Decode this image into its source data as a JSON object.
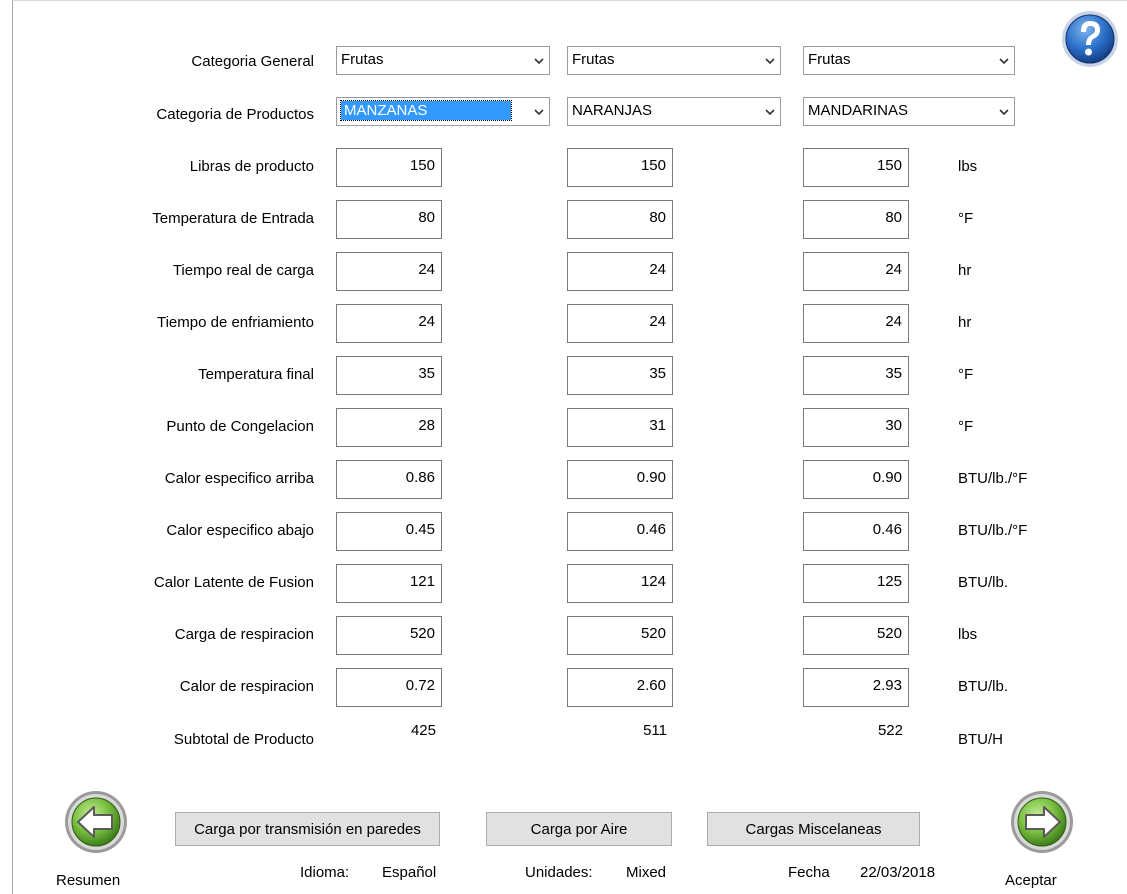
{
  "help_icon": "help-question-icon",
  "row_labels": {
    "categoria_general": "Categoria General",
    "categoria_productos": "Categoria de Productos",
    "libras": "Libras de producto",
    "temp_entrada": "Temperatura de Entrada",
    "tiempo_carga": "Tiempo real de carga",
    "tiempo_enfriamiento": "Tiempo de enfriamiento",
    "temp_final": "Temperatura final",
    "punto_congelacion": "Punto de Congelacion",
    "calor_arriba": "Calor especifico arriba",
    "calor_abajo": "Calor especifico abajo",
    "calor_latente": "Calor Latente de Fusion",
    "carga_respiracion": "Carga de respiracion",
    "calor_respiracion": "Calor de respiracion",
    "subtotal": "Subtotal de Producto"
  },
  "columns": [
    {
      "categoria_general": "Frutas",
      "categoria_productos": "MANZANAS",
      "libras": "150",
      "temp_entrada": "80",
      "tiempo_carga": "24",
      "tiempo_enfriamiento": "24",
      "temp_final": "35",
      "punto_congelacion": "28",
      "calor_arriba": "0.86",
      "calor_abajo": "0.45",
      "calor_latente": "121",
      "carga_respiracion": "520",
      "calor_respiracion": "0.72",
      "subtotal": "425"
    },
    {
      "categoria_general": "Frutas",
      "categoria_productos": "NARANJAS",
      "libras": "150",
      "temp_entrada": "80",
      "tiempo_carga": "24",
      "tiempo_enfriamiento": "24",
      "temp_final": "35",
      "punto_congelacion": "31",
      "calor_arriba": "0.90",
      "calor_abajo": "0.46",
      "calor_latente": "124",
      "carga_respiracion": "520",
      "calor_respiracion": "2.60",
      "subtotal": "511"
    },
    {
      "categoria_general": "Frutas",
      "categoria_productos": "MANDARINAS",
      "libras": "150",
      "temp_entrada": "80",
      "tiempo_carga": "24",
      "tiempo_enfriamiento": "24",
      "temp_final": "35",
      "punto_congelacion": "30",
      "calor_arriba": "0.90",
      "calor_abajo": "0.46",
      "calor_latente": "125",
      "carga_respiracion": "520",
      "calor_respiracion": "2.93",
      "subtotal": "522"
    }
  ],
  "units": {
    "libras": "lbs",
    "temp_entrada": "°F",
    "tiempo_carga": "hr",
    "tiempo_enfriamiento": "hr",
    "temp_final": "°F",
    "punto_congelacion": "°F",
    "calor_arriba": "BTU/lb./°F",
    "calor_abajo": "BTU/lb./°F",
    "calor_latente": "BTU/lb.",
    "carga_respiracion": "lbs",
    "calor_respiracion": "BTU/lb.",
    "subtotal": "BTU/H"
  },
  "buttons": {
    "transmision": "Carga por transmisión en paredes",
    "aire": "Carga por Aire",
    "miscelaneas": "Cargas Miscelaneas"
  },
  "nav": {
    "back_label": "Resumen",
    "next_label": "Aceptar",
    "back_icon": "arrow-left-icon",
    "next_icon": "arrow-right-icon"
  },
  "footer": {
    "idioma_label": "Idioma:",
    "idioma_value": "Español",
    "unidades_label": "Unidades:",
    "unidades_value": "Mixed",
    "fecha_label": "Fecha",
    "fecha_value": "22/03/2018"
  },
  "colors": {
    "selection": "#3399ff",
    "nav_green": "#7cc242",
    "help_blue": "#1e63c0"
  }
}
